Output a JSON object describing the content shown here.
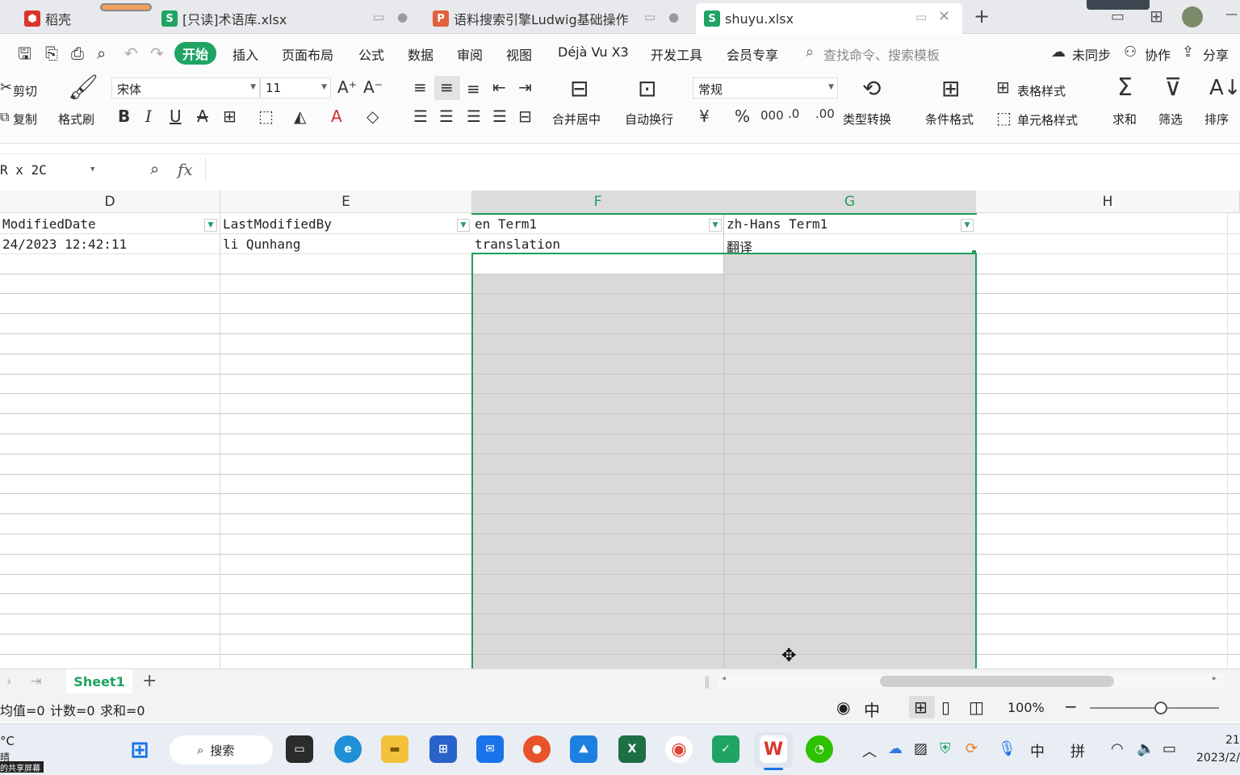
{
  "tabs": [
    {
      "title": "稻壳",
      "icon": "daoke-icon"
    },
    {
      "title": "[只读]术语库.xlsx",
      "icon": "spreadsheet-icon"
    },
    {
      "title": "语料搜索引擎Ludwig基础操作",
      "icon": "presentation-icon"
    },
    {
      "title": "shuyu.xlsx",
      "icon": "spreadsheet-icon"
    }
  ],
  "menu": {
    "start": "开始",
    "items": [
      "插入",
      "页面布局",
      "公式",
      "数据",
      "审阅",
      "视图",
      "Déjà Vu X3",
      "开发工具",
      "会员专享"
    ],
    "search_placeholder": "查找命令、搜索模板",
    "sync": "未同步",
    "collab": "协作",
    "share": "分享"
  },
  "ribbon": {
    "cut": "剪切",
    "copy": "复制",
    "format_painter": "格式刷",
    "font_name": "宋体",
    "font_size": "11",
    "merge_center": "合并居中",
    "auto_wrap": "自动换行",
    "number_format": "常规",
    "type_convert": "类型转换",
    "cond_format": "条件格式",
    "table_style": "表格样式",
    "cell_style": "单元格样式",
    "sum": "求和",
    "filter": "筛选",
    "sort": "排序"
  },
  "formula_bar": {
    "name_box": "R x 2C",
    "fx": "fx",
    "formula": ""
  },
  "grid": {
    "columns": [
      "D",
      "E",
      "F",
      "G",
      "H"
    ],
    "header_row": [
      "ModifiedDate",
      "LastModifiedBy",
      "en Term1",
      "zh-Hans Term1",
      ""
    ],
    "data_row": [
      "24/2023 12:42:11",
      "li Qunhang",
      "translation",
      "翻译",
      ""
    ]
  },
  "sheets": {
    "active": "Sheet1",
    "add": "+"
  },
  "status": {
    "average": "均值=0",
    "count": "计数=0",
    "sum": "求和=0",
    "zoom": "100%"
  },
  "taskbar": {
    "search": "搜索",
    "weather_temp": "°C",
    "weather_desc": "晴",
    "share_notice": "的共享屏幕",
    "ime1": "中",
    "ime2": "拼",
    "time": "21",
    "date": "2023/2/"
  },
  "colors": {
    "accent": "#1fa463",
    "selection": "#d9d9d9",
    "selection_border": "#1f9e5a"
  }
}
